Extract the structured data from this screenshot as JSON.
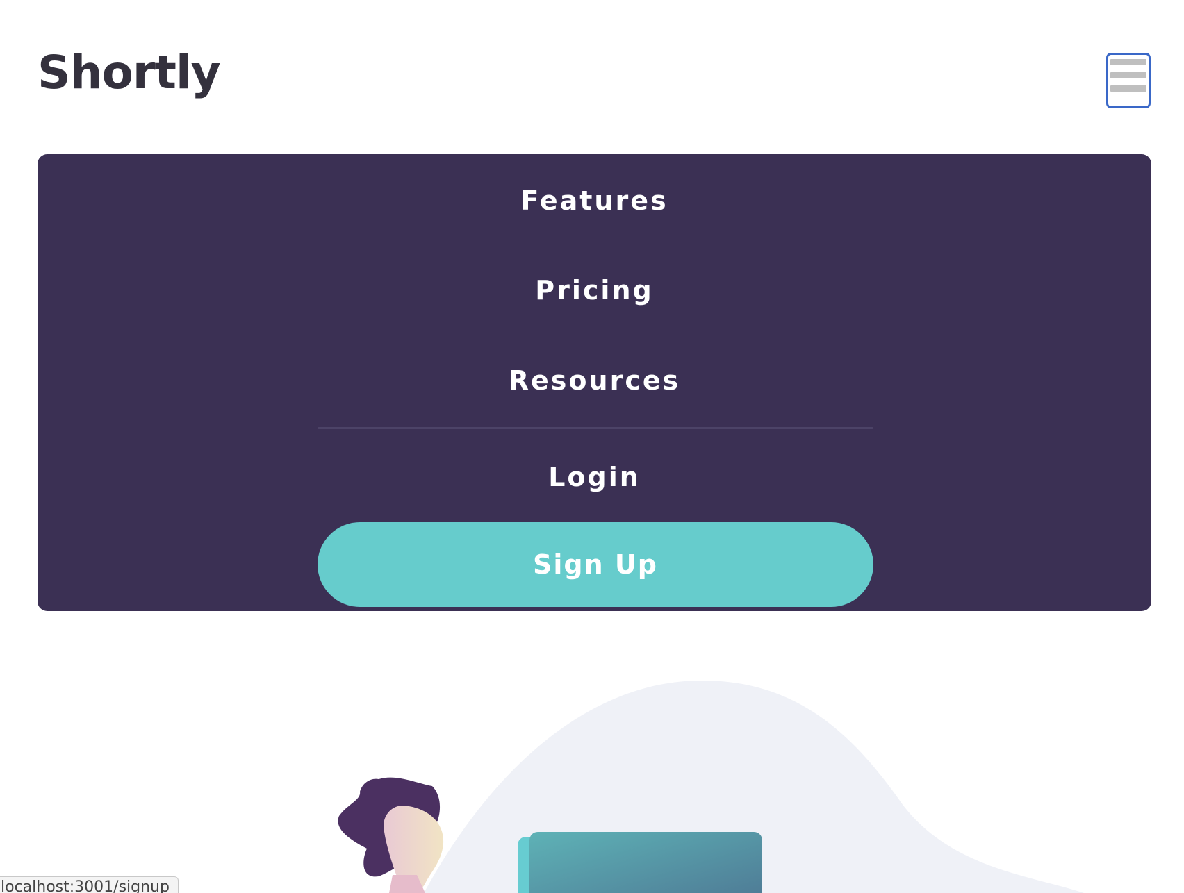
{
  "header": {
    "logo_text": "Shortly",
    "menu_icon": "hamburger-icon"
  },
  "nav": {
    "items": [
      {
        "label": "Features"
      },
      {
        "label": "Pricing"
      },
      {
        "label": "Resources"
      }
    ],
    "login_label": "Login",
    "signup_label": "Sign Up"
  },
  "status_bar": {
    "url": "localhost:3001/signup"
  },
  "colors": {
    "logo_text": "#34313d",
    "menu_background": "#3b3054",
    "accent_cyan": "#66cccc",
    "menu_text": "#ffffff",
    "focus_outline": "#3a68c8",
    "blob_background": "#eff1f7",
    "hair": "#4b3061"
  }
}
